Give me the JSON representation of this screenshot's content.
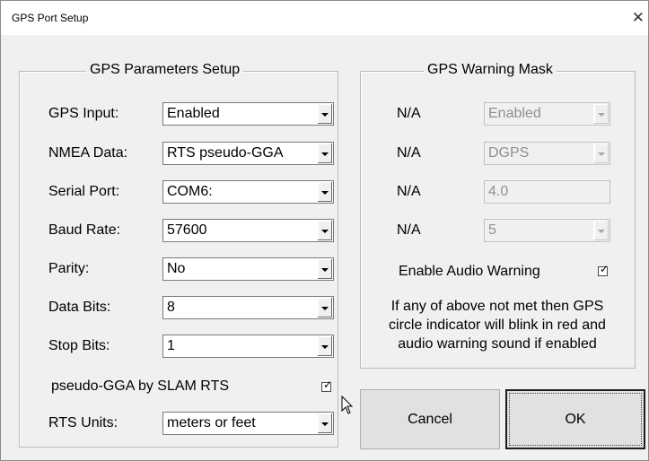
{
  "window": {
    "title": "GPS Port Setup",
    "close_glyph": "✕"
  },
  "params": {
    "group_title": "GPS Parameters Setup",
    "gps_input": {
      "label": "GPS Input:",
      "value": "Enabled"
    },
    "nmea_data": {
      "label": "NMEA Data:",
      "value": "RTS pseudo-GGA"
    },
    "serial_port": {
      "label": "Serial Port:",
      "value": "COM6:"
    },
    "baud_rate": {
      "label": "Baud Rate:",
      "value": "57600"
    },
    "parity": {
      "label": "Parity:",
      "value": "No"
    },
    "data_bits": {
      "label": "Data Bits:",
      "value": "8"
    },
    "stop_bits": {
      "label": "Stop Bits:",
      "value": "1"
    },
    "pseudo_gga": {
      "label": "pseudo-GGA by SLAM RTS",
      "checked": true
    },
    "rts_units": {
      "label": "RTS Units:",
      "value": "meters or feet"
    }
  },
  "warning": {
    "group_title": "GPS Warning Mask",
    "row1": {
      "label": "N/A",
      "value": "Enabled"
    },
    "row2": {
      "label": "N/A",
      "value": "DGPS"
    },
    "row3": {
      "label": "N/A",
      "value": "4.0"
    },
    "row4": {
      "label": "N/A",
      "value": "5"
    },
    "audio": {
      "label": "Enable Audio Warning",
      "checked": true
    },
    "note_line1": "If any of above not met then GPS",
    "note_line2": "circle indicator will blink in red and",
    "note_line3": "audio warning sound if enabled"
  },
  "buttons": {
    "cancel": "Cancel",
    "ok": "OK"
  },
  "checkmark": "✓"
}
